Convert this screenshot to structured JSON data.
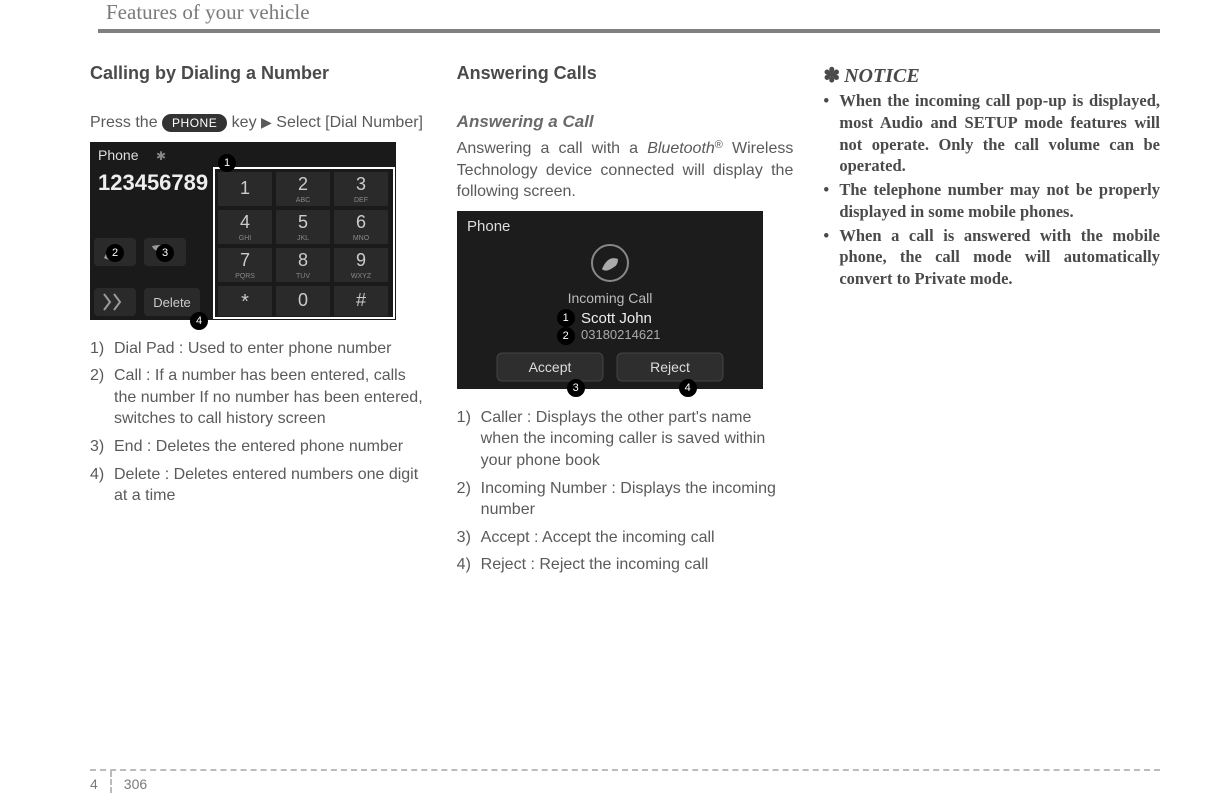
{
  "header": "Features of your vehicle",
  "footer": {
    "chapter": "4",
    "page": "306"
  },
  "col1": {
    "heading": "Calling by Dialing a Number",
    "intro_pre": "Press the ",
    "key_label": "PHONE",
    "intro_post": " key",
    "intro_tri": "▶",
    "intro_end": "Select [Dial Number]",
    "fig": {
      "title": "Phone",
      "number": "123456789",
      "btn_delete": "Delete",
      "keys": [
        [
          "1",
          ""
        ],
        [
          "2",
          "ABC"
        ],
        [
          "3",
          "DEF"
        ],
        [
          "4",
          "GHI"
        ],
        [
          "5",
          "JKL"
        ],
        [
          "6",
          "MNO"
        ],
        [
          "7",
          "PQRS"
        ],
        [
          "8",
          "TUV"
        ],
        [
          "9",
          "WXYZ"
        ],
        [
          "*",
          ""
        ],
        [
          "0",
          ""
        ],
        [
          "#",
          ""
        ]
      ]
    },
    "items": [
      {
        "n": "1)",
        "t": "Dial Pad : Used to enter phone number"
      },
      {
        "n": "2)",
        "t": "Call : If a number has been entered, calls the number If no number has been entered, switches to call history screen"
      },
      {
        "n": "3)",
        "t": "End : Deletes the entered phone number"
      },
      {
        "n": "4)",
        "t": "Delete : Deletes entered numbers one digit at a time"
      }
    ]
  },
  "col2": {
    "heading": "Answering Calls",
    "subheading": "Answering a Call",
    "intro_a": "Answering a call with a ",
    "intro_bt": "Bluetooth",
    "intro_reg": "®",
    "intro_b": " Wireless Technology device connected will display the following screen.",
    "fig": {
      "title": "Phone",
      "label": "Incoming Call",
      "name": "Scott John",
      "num": "03180214621",
      "accept": "Accept",
      "reject": "Reject"
    },
    "items": [
      {
        "n": "1)",
        "t": "Caller : Displays the other part's name when the incoming caller is saved within your phone book"
      },
      {
        "n": "2)",
        "t": "Incoming Number : Displays the incoming number"
      },
      {
        "n": "3)",
        "t": "Accept : Accept the incoming call"
      },
      {
        "n": "4)",
        "t": "Reject : Reject the incoming call"
      }
    ]
  },
  "col3": {
    "notice_sym": "✽",
    "notice_title": "NOTICE",
    "items": [
      "When the incoming call pop-up is displayed, most Audio and SETUP mode features will not operate. Only the call volume can be operated.",
      "The telephone number may not be properly displayed in some mobile phones.",
      "When a call is answered with the mobile phone, the call mode will automatically convert to Private mode."
    ]
  }
}
